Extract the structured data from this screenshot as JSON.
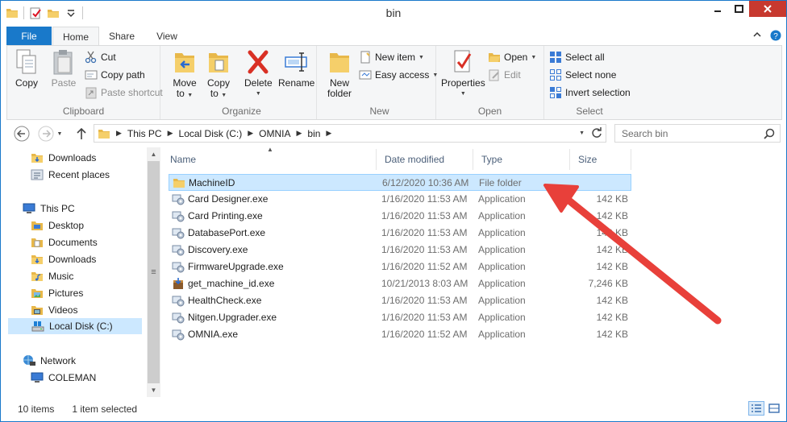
{
  "window": {
    "title": "bin",
    "controls": [
      "minimize",
      "maximize",
      "close"
    ]
  },
  "quick_access_icons": [
    "folder-icon",
    "properties-icon",
    "new-folder-icon",
    "customize-icon"
  ],
  "ribbon_tabs": [
    {
      "label": "File",
      "active": false
    },
    {
      "label": "Home",
      "active": true
    },
    {
      "label": "Share",
      "active": false
    },
    {
      "label": "View",
      "active": false
    }
  ],
  "ribbon": {
    "clipboard": {
      "label": "Clipboard",
      "copy": "Copy",
      "paste": "Paste",
      "cut": "Cut",
      "copy_path": "Copy path",
      "paste_shortcut": "Paste shortcut"
    },
    "organize": {
      "label": "Organize",
      "move_to_line1": "Move",
      "move_to_line2": "to",
      "copy_to_line1": "Copy",
      "copy_to_line2": "to",
      "delete": "Delete",
      "rename": "Rename"
    },
    "new": {
      "label": "New",
      "new_folder_line1": "New",
      "new_folder_line2": "folder",
      "new_item": "New item",
      "easy_access": "Easy access"
    },
    "open": {
      "label": "Open",
      "properties": "Properties",
      "open": "Open",
      "edit": "Edit"
    },
    "select": {
      "label": "Select",
      "select_all": "Select all",
      "select_none": "Select none",
      "invert_selection": "Invert selection"
    }
  },
  "address": {
    "crumbs": [
      "This PC",
      "Local Disk (C:)",
      "OMNIA",
      "bin"
    ],
    "search_placeholder": "Search bin"
  },
  "nav_pane": {
    "items": [
      {
        "label": "Downloads",
        "icon": "downloads-folder-icon",
        "indent": 1
      },
      {
        "label": "Recent places",
        "icon": "recent-places-icon",
        "indent": 1
      },
      {
        "label": "This PC",
        "icon": "computer-icon",
        "indent": 0
      },
      {
        "label": "Desktop",
        "icon": "desktop-folder-icon",
        "indent": 1
      },
      {
        "label": "Documents",
        "icon": "documents-folder-icon",
        "indent": 1
      },
      {
        "label": "Downloads",
        "icon": "downloads-folder-icon",
        "indent": 1
      },
      {
        "label": "Music",
        "icon": "music-folder-icon",
        "indent": 1
      },
      {
        "label": "Pictures",
        "icon": "pictures-folder-icon",
        "indent": 1
      },
      {
        "label": "Videos",
        "icon": "videos-folder-icon",
        "indent": 1
      },
      {
        "label": "Local Disk (C:)",
        "icon": "drive-icon",
        "indent": 1,
        "selected": true
      },
      {
        "label": "Network",
        "icon": "network-icon",
        "indent": 0
      },
      {
        "label": "COLEMAN",
        "icon": "computer-icon",
        "indent": 1
      }
    ]
  },
  "columns": {
    "name": "Name",
    "date": "Date modified",
    "type": "Type",
    "size": "Size"
  },
  "files": [
    {
      "name": "MachineID",
      "date": "6/12/2020 10:36 AM",
      "type": "File folder",
      "size": "",
      "icon": "folder-icon",
      "selected": true
    },
    {
      "name": "Card Designer.exe",
      "date": "1/16/2020 11:53 AM",
      "type": "Application",
      "size": "142 KB",
      "icon": "application-icon"
    },
    {
      "name": "Card Printing.exe",
      "date": "1/16/2020 11:53 AM",
      "type": "Application",
      "size": "142 KB",
      "icon": "application-icon"
    },
    {
      "name": "DatabasePort.exe",
      "date": "1/16/2020 11:53 AM",
      "type": "Application",
      "size": "142 KB",
      "icon": "application-icon"
    },
    {
      "name": "Discovery.exe",
      "date": "1/16/2020 11:53 AM",
      "type": "Application",
      "size": "142 KB",
      "icon": "application-icon"
    },
    {
      "name": "FirmwareUpgrade.exe",
      "date": "1/16/2020 11:52 AM",
      "type": "Application",
      "size": "142 KB",
      "icon": "application-icon"
    },
    {
      "name": "get_machine_id.exe",
      "date": "10/21/2013 8:03 AM",
      "type": "Application",
      "size": "7,246 KB",
      "icon": "installer-icon"
    },
    {
      "name": "HealthCheck.exe",
      "date": "1/16/2020 11:53 AM",
      "type": "Application",
      "size": "142 KB",
      "icon": "application-icon"
    },
    {
      "name": "Nitgen.Upgrader.exe",
      "date": "1/16/2020 11:53 AM",
      "type": "Application",
      "size": "142 KB",
      "icon": "application-icon"
    },
    {
      "name": "OMNIA.exe",
      "date": "1/16/2020 11:52 AM",
      "type": "Application",
      "size": "142 KB",
      "icon": "application-icon"
    }
  ],
  "status": {
    "items": "10 items",
    "selected": "1 item selected"
  },
  "colors": {
    "accent": "#1979ca",
    "selection": "#cce8ff",
    "annotation_arrow": "#e8403a"
  }
}
